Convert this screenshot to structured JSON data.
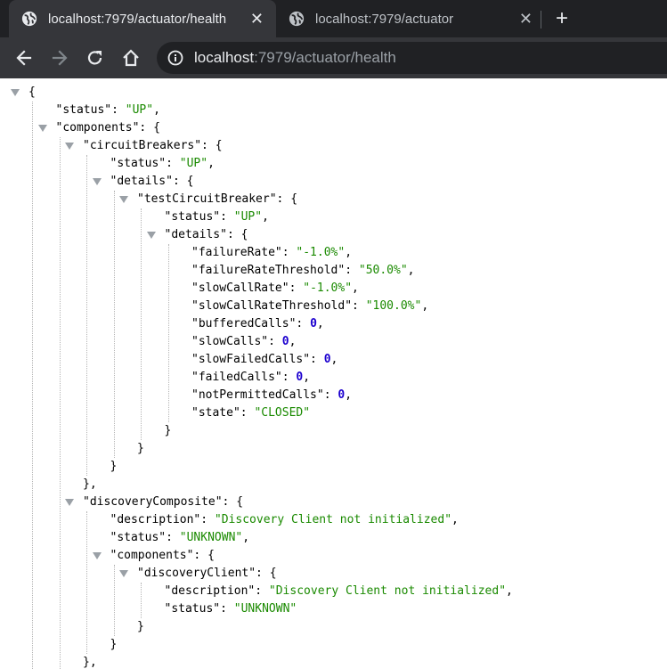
{
  "tabs": [
    {
      "title": "localhost:7979/actuator/health",
      "active": true
    },
    {
      "title": "localhost:7979/actuator",
      "active": false
    }
  ],
  "tab_close_symbol": "✕",
  "new_tab_symbol": "+",
  "address_bar": {
    "host": "localhost",
    "path": ":7979/actuator/health"
  },
  "icons": {
    "tab_icon": "globe-icon",
    "back": "arrow-left-icon",
    "forward": "arrow-right-icon",
    "reload": "reload-icon",
    "home": "home-icon",
    "site_info": "info-icon"
  },
  "colors": {
    "json_string": "#1a8a00",
    "json_number": "#1c00cf",
    "chrome_dark": "#202124",
    "chrome_toolbar": "#35363a"
  },
  "json_lines": [
    {
      "depth": 0,
      "toggle": true,
      "open": "{"
    },
    {
      "depth": 1,
      "key": "status",
      "str": "UP",
      "comma": true
    },
    {
      "depth": 1,
      "toggle": true,
      "key": "components",
      "open": "{"
    },
    {
      "depth": 2,
      "toggle": true,
      "key": "circuitBreakers",
      "open": "{"
    },
    {
      "depth": 3,
      "key": "status",
      "str": "UP",
      "comma": true
    },
    {
      "depth": 3,
      "toggle": true,
      "key": "details",
      "open": "{"
    },
    {
      "depth": 4,
      "toggle": true,
      "key": "testCircuitBreaker",
      "open": "{"
    },
    {
      "depth": 5,
      "key": "status",
      "str": "UP",
      "comma": true
    },
    {
      "depth": 5,
      "toggle": true,
      "key": "details",
      "open": "{"
    },
    {
      "depth": 6,
      "key": "failureRate",
      "str": "-1.0%",
      "comma": true
    },
    {
      "depth": 6,
      "key": "failureRateThreshold",
      "str": "50.0%",
      "comma": true
    },
    {
      "depth": 6,
      "key": "slowCallRate",
      "str": "-1.0%",
      "comma": true
    },
    {
      "depth": 6,
      "key": "slowCallRateThreshold",
      "str": "100.0%",
      "comma": true
    },
    {
      "depth": 6,
      "key": "bufferedCalls",
      "num": "0",
      "comma": true
    },
    {
      "depth": 6,
      "key": "slowCalls",
      "num": "0",
      "comma": true
    },
    {
      "depth": 6,
      "key": "slowFailedCalls",
      "num": "0",
      "comma": true
    },
    {
      "depth": 6,
      "key": "failedCalls",
      "num": "0",
      "comma": true
    },
    {
      "depth": 6,
      "key": "notPermittedCalls",
      "num": "0",
      "comma": true
    },
    {
      "depth": 6,
      "key": "state",
      "str": "CLOSED"
    },
    {
      "depth": 5,
      "close": "}"
    },
    {
      "depth": 4,
      "close": "}"
    },
    {
      "depth": 3,
      "close": "}"
    },
    {
      "depth": 2,
      "close": "}",
      "comma": true
    },
    {
      "depth": 2,
      "toggle": true,
      "key": "discoveryComposite",
      "open": "{"
    },
    {
      "depth": 3,
      "key": "description",
      "str": "Discovery Client not initialized",
      "comma": true
    },
    {
      "depth": 3,
      "key": "status",
      "str": "UNKNOWN",
      "comma": true
    },
    {
      "depth": 3,
      "toggle": true,
      "key": "components",
      "open": "{"
    },
    {
      "depth": 4,
      "toggle": true,
      "key": "discoveryClient",
      "open": "{"
    },
    {
      "depth": 5,
      "key": "description",
      "str": "Discovery Client not initialized",
      "comma": true
    },
    {
      "depth": 5,
      "key": "status",
      "str": "UNKNOWN"
    },
    {
      "depth": 4,
      "close": "}"
    },
    {
      "depth": 3,
      "close": "}"
    },
    {
      "depth": 2,
      "close": "}",
      "comma": true
    }
  ]
}
